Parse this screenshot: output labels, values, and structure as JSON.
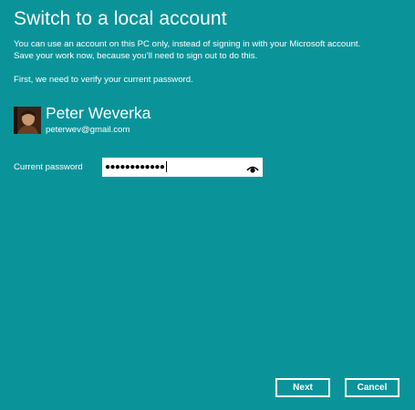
{
  "dialog": {
    "title": "Switch to a local account",
    "description_line1": "You can use an account on this PC only, instead of signing in with your Microsoft account.",
    "description_line2": "Save your work now, because you’ll need to sign out to do this.",
    "verify_prompt": "First, we need to verify your current password."
  },
  "user": {
    "name": "Peter Weverka",
    "email": "peterwev@gmail.com",
    "avatar_icon": "user-photo"
  },
  "password": {
    "label": "Current password",
    "masked_value": "●●●●●●●●●●●●",
    "reveal_icon": "eye-icon"
  },
  "buttons": {
    "next": "Next",
    "cancel": "Cancel"
  },
  "colors": {
    "background": "#0a949a",
    "text": "#ffffff",
    "field": "#ffffff"
  }
}
